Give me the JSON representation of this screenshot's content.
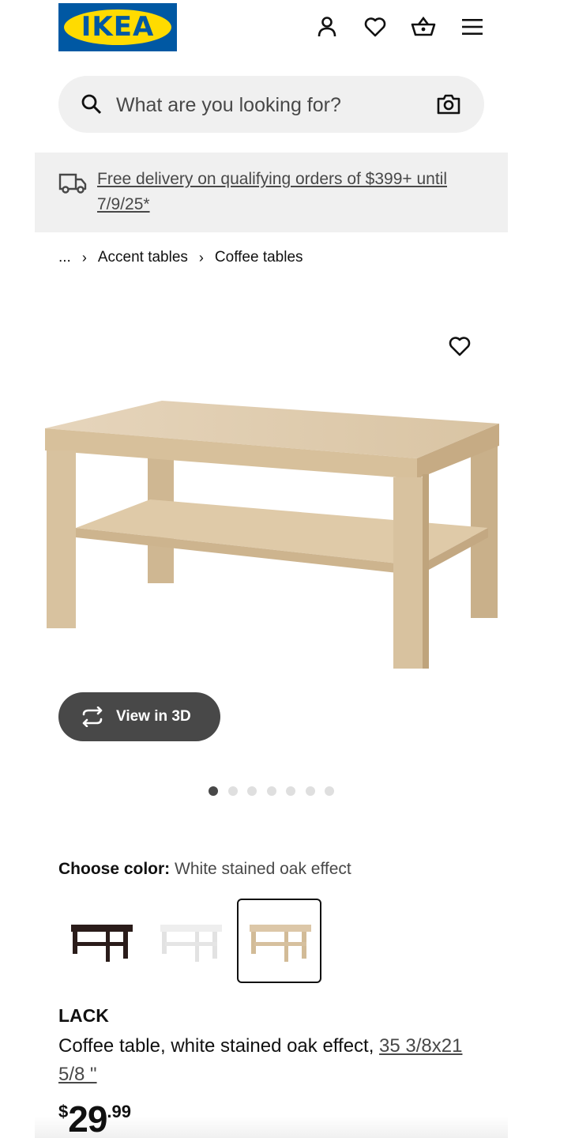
{
  "brand": {
    "logo_text": "IKEA",
    "colors": {
      "blue": "#0058a3",
      "yellow": "#ffdb00"
    }
  },
  "header": {
    "icons": [
      "person-icon",
      "heart-icon",
      "basket-icon",
      "menu-icon"
    ]
  },
  "search": {
    "placeholder": "What are you looking for?",
    "camera_icon": "camera-icon"
  },
  "banner": {
    "text": "Free delivery on qualifying orders of $399+ until 7/9/25*"
  },
  "breadcrumb": {
    "ellipsis": "...",
    "items": [
      "Accent tables",
      "Coffee tables"
    ],
    "separator": "›"
  },
  "gallery": {
    "view_3d_label": "View in 3D",
    "dot_count": 7,
    "active_dot": 0
  },
  "color_choice": {
    "label": "Choose color:",
    "selected_value": "White stained oak effect",
    "options": [
      {
        "name": "black-brown",
        "color": "#2a1c1a"
      },
      {
        "name": "white",
        "color": "#f2f2f2"
      },
      {
        "name": "white stained oak effect",
        "color": "#dcc7a8"
      }
    ],
    "selected_index": 2
  },
  "product": {
    "name": "LACK",
    "description": "Coffee table, white stained oak effect,",
    "dimensions": "35 3/8x21 5/8 \"",
    "price": {
      "currency": "$",
      "integer": "29",
      "decimal": ".99"
    }
  }
}
